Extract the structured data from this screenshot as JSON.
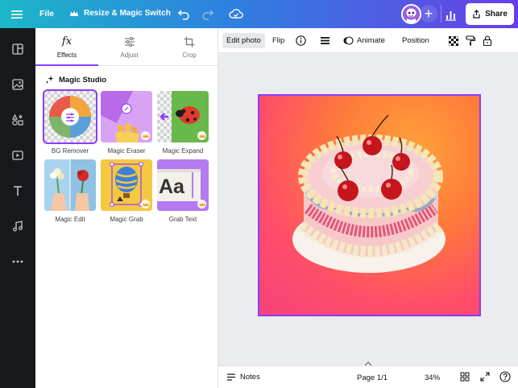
{
  "topbar": {
    "file_label": "File",
    "resize_label": "Resize & Magic Switch",
    "share_label": "Share",
    "icons": [
      "menu-icon",
      "crown-icon",
      "undo-icon",
      "redo-icon",
      "cloud-icon",
      "plus-icon",
      "analytics-icon",
      "share-icon"
    ]
  },
  "rail": {
    "icons": [
      "design-icon",
      "photo-icon",
      "elements-icon",
      "video-icon",
      "text-icon",
      "music-icon",
      "more-icon"
    ]
  },
  "panel": {
    "tabs": [
      {
        "label": "Effects",
        "icon": "fx-icon"
      },
      {
        "label": "Adjust",
        "icon": "sliders-icon"
      },
      {
        "label": "Crop",
        "icon": "crop-icon"
      }
    ],
    "section_title": "Magic Studio",
    "tools": [
      {
        "label": "BG Remover",
        "icon": "bg-remover-icon"
      },
      {
        "label": "Magic Eraser",
        "icon": "magic-eraser-icon"
      },
      {
        "label": "Magic Expand",
        "icon": "magic-expand-icon"
      },
      {
        "label": "Magic Edit",
        "icon": "magic-edit-icon"
      },
      {
        "label": "Magic Grab",
        "icon": "magic-grab-icon"
      },
      {
        "label": "Grab Text",
        "icon": "grab-text-icon"
      }
    ],
    "grab_text_sample": "Aa"
  },
  "context_toolbar": {
    "edit_photo": "Edit photo",
    "flip": "Flip",
    "animate": "Animate",
    "position": "Position"
  },
  "bottombar": {
    "notes": "Notes",
    "page": "Page 1/1",
    "zoom": "34%"
  },
  "colors": {
    "accent": "#8b3dff",
    "rail_bg": "#18191b",
    "canvas_bg": "#ebecf0"
  }
}
